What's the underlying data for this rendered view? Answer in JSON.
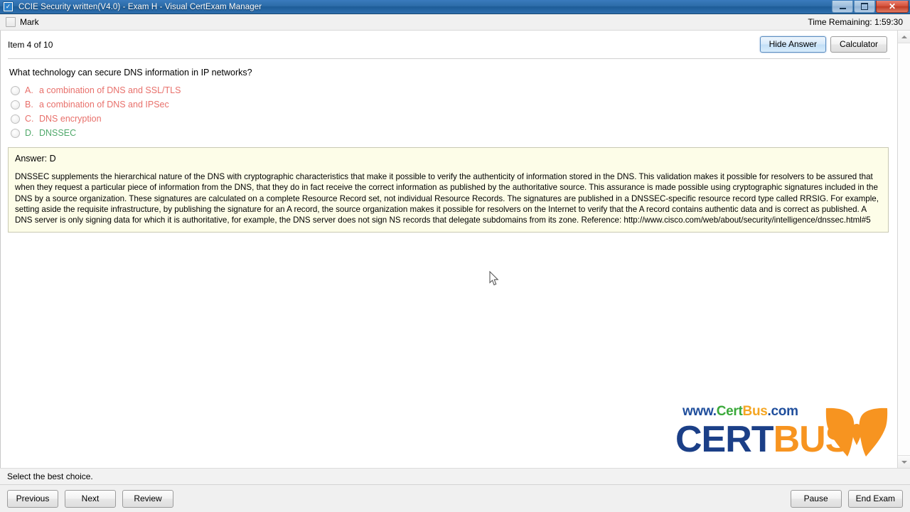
{
  "window": {
    "title": "CCIE Security written(V4.0) - Exam H - Visual CertExam Manager",
    "icon": "checkbox-app-icon",
    "minimize_label": "–",
    "maximize_label": "□",
    "close_label": "✕"
  },
  "toolbar": {
    "mark_label": "Mark",
    "mark_checked": false,
    "timer_label": "Time Remaining: 1:59:30"
  },
  "header": {
    "item_counter": "Item 4 of 10",
    "hide_answer_label": "Hide Answer",
    "calculator_label": "Calculator"
  },
  "question": {
    "text": "What technology can secure DNS information in IP networks?",
    "options": [
      {
        "letter": "A.",
        "text": "a combination of DNS and SSL/TLS",
        "state": "wrong"
      },
      {
        "letter": "B.",
        "text": "a combination of DNS and IPSec",
        "state": "wrong"
      },
      {
        "letter": "C.",
        "text": "DNS encryption",
        "state": "wrong"
      },
      {
        "letter": "D.",
        "text": "DNSSEC",
        "state": "correct"
      }
    ]
  },
  "answer": {
    "heading": "Answer: D",
    "explanation": "DNSSEC supplements the hierarchical nature of the DNS with cryptographic characteristics that make it possible to verify the authenticity of information stored in the DNS. This validation makes it possible for resolvers to be assured that when they request a particular piece of information from the DNS, that they do in fact receive the correct information as published by the authoritative source. This assurance is made possible using cryptographic signatures included in the DNS by a source organization. These signatures are calculated on a complete Resource Record set, not individual Resource Records. The signatures are published in a DNSSEC-specific resource record type called RRSIG. For example, setting aside the requisite infrastructure, by publishing the signature for an A record, the source organization makes it possible for resolvers on the Internet to verify that the A record contains authentic data and is correct as published. A DNS server is only signing data for which it is authoritative, for example, the DNS server does not sign NS records that delegate subdomains from its zone. Reference: http://www.cisco.com/web/about/security/intelligence/dnssec.html#5"
  },
  "logo": {
    "url_www": "www.",
    "url_cert": "Cert",
    "url_bus": "Bus",
    "url_com": ".com",
    "word_cert": "CERT",
    "word_bus": "BUS"
  },
  "status": {
    "text": "Select the best choice."
  },
  "footer": {
    "previous_label": "Previous",
    "next_label": "Next",
    "review_label": "Review",
    "pause_label": "Pause",
    "end_exam_label": "End Exam"
  },
  "colors": {
    "wrong_option": "#e8706b",
    "correct_option": "#4fa86a",
    "answer_bg": "#fdfde8",
    "title_bar": "#2c6ca8",
    "logo_blue": "#1b3f87",
    "logo_orange": "#f79420",
    "logo_green": "#3aa93a"
  }
}
